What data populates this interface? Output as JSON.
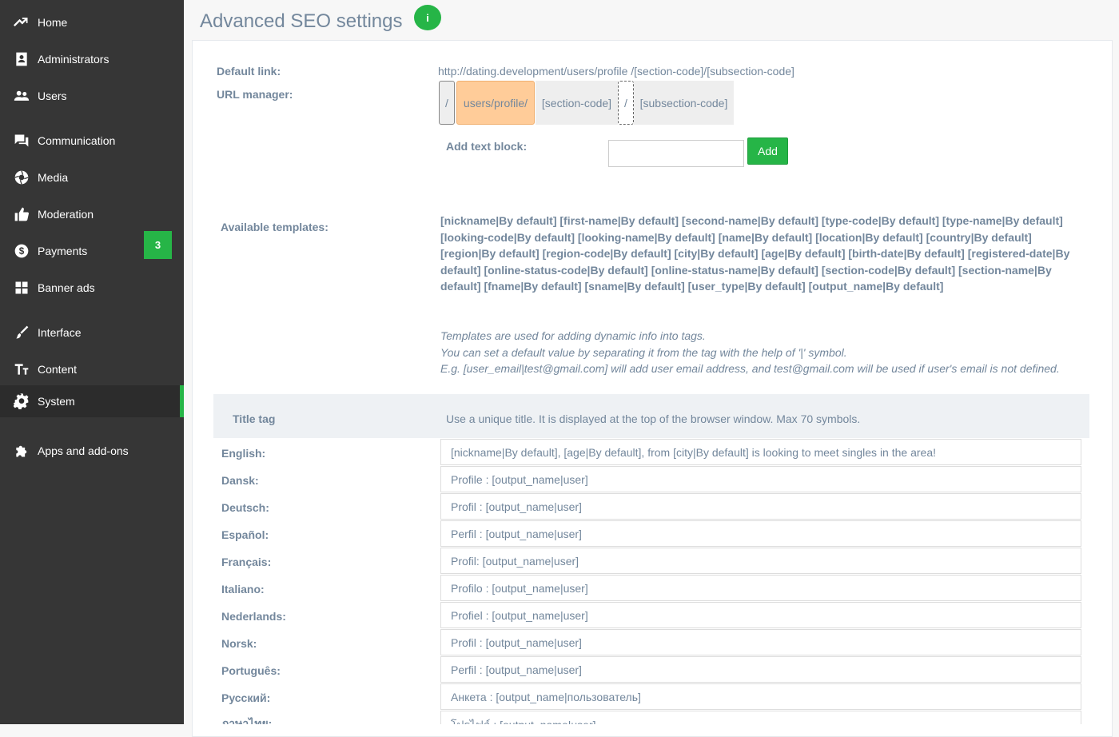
{
  "sidebar": {
    "items": [
      {
        "label": "Home",
        "icon": "trending-up-icon"
      },
      {
        "label": "Administrators",
        "icon": "contact-card-icon"
      },
      {
        "label": "Users",
        "icon": "users-icon"
      },
      {
        "label": "Communication",
        "icon": "chat-icon"
      },
      {
        "label": "Media",
        "icon": "camera-aperture-icon"
      },
      {
        "label": "Moderation",
        "icon": "thumbs-up-icon"
      },
      {
        "label": "Payments",
        "icon": "dollar-icon"
      },
      {
        "label": "Banner ads",
        "icon": "grid-icon"
      },
      {
        "label": "Interface",
        "icon": "brush-icon"
      },
      {
        "label": "Content",
        "icon": "text-size-icon"
      },
      {
        "label": "System",
        "icon": "gear-icon"
      },
      {
        "label": "Apps and add-ons",
        "icon": "puzzle-icon"
      }
    ],
    "active": "System",
    "payments_badge": "3",
    "accent": "#26b547"
  },
  "header": {
    "title": "Advanced SEO settings",
    "info_icon": "i"
  },
  "form": {
    "default_link_label": "Default link:",
    "default_link_value": "http://dating.development/users/profile /[section-code]/[subsection-code]",
    "url_manager_label": "URL manager:",
    "url_blocks": [
      "/",
      "users/profile/",
      "[section-code]",
      "/",
      "[subsection-code]"
    ],
    "add_text_block_label": "Add text block:",
    "add_text_block_value": "",
    "add_button": "Add",
    "available_templates_label": "Available templates:",
    "templates_text": "[nickname|By default] [first-name|By default] [second-name|By default] [type-code|By default] [type-name|By default] [looking-code|By default] [looking-name|By default] [name|By default] [location|By default] [country|By default] [region|By default] [region-code|By default] [city|By default] [age|By default] [birth-date|By default] [registered-date|By default] [online-status-code|By default] [online-status-name|By default] [section-code|By default] [section-name|By default] [fname|By default] [sname|By default] [user_type|By default] [output_name|By default]",
    "help_lines": [
      "Templates are used for adding dynamic info into tags.",
      "You can set a default value by separating it from the tag with the help of '|' symbol.",
      "E.g. [user_email|test@gmail.com] will add user email address, and test@gmail.com will be used if user's email is not defined."
    ],
    "title_tag_label": "Title tag",
    "title_tag_hint": "Use a unique title. It is displayed at the top of the browser window. Max 70 symbols.",
    "languages": [
      {
        "label": "English:",
        "value": "[nickname|By default], [age|By default], from [city|By default] is looking to meet singles in the area!"
      },
      {
        "label": "Dansk:",
        "value": "Profile : [output_name|user]"
      },
      {
        "label": "Deutsch:",
        "value": "Profil : [output_name|user]"
      },
      {
        "label": "Español:",
        "value": "Perfil : [output_name|user]"
      },
      {
        "label": "Français:",
        "value": "Profil: [output_name|user]"
      },
      {
        "label": "Italiano:",
        "value": "Profilo : [output_name|user]"
      },
      {
        "label": "Nederlands:",
        "value": "Profiel : [output_name|user]"
      },
      {
        "label": "Norsk:",
        "value": "Profil : [output_name|user]"
      },
      {
        "label": "Português:",
        "value": "Perfil : [output_name|user]"
      },
      {
        "label": "Русский:",
        "value": "Анкета : [output_name|пользователь]"
      },
      {
        "label": "ภาษาไทย:",
        "value": "โปรไฟล์ : [output_name|user]"
      }
    ]
  }
}
